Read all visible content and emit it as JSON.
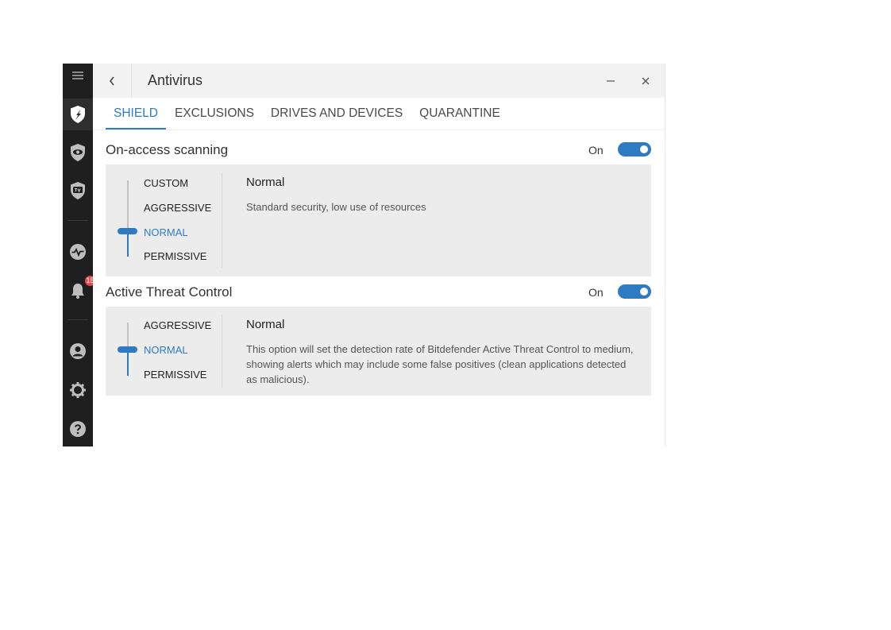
{
  "window": {
    "title": "Antivirus"
  },
  "sidebar": {
    "notifications_count": "15"
  },
  "tabs": [
    {
      "label": "SHIELD",
      "active": true
    },
    {
      "label": "EXCLUSIONS",
      "active": false
    },
    {
      "label": "DRIVES AND DEVICES",
      "active": false
    },
    {
      "label": "QUARANTINE",
      "active": false
    }
  ],
  "on_access": {
    "title": "On-access scanning",
    "toggle_label": "On",
    "toggle_on": true,
    "levels": [
      "CUSTOM",
      "AGGRESSIVE",
      "NORMAL",
      "PERMISSIVE"
    ],
    "selected_level": "NORMAL",
    "detail_title": "Normal",
    "detail_desc": "Standard security, low use of resources"
  },
  "atc": {
    "title": "Active Threat Control",
    "toggle_label": "On",
    "toggle_on": true,
    "levels": [
      "AGGRESSIVE",
      "NORMAL",
      "PERMISSIVE"
    ],
    "selected_level": "NORMAL",
    "detail_title": "Normal",
    "detail_desc": "This option will set the detection rate of Bitdefender Active Threat Control to medium, showing alerts which may include some false positives (clean applications detected as malicious)."
  },
  "colors": {
    "accent": "#2e7bc4",
    "sidebar_bg": "#1f1f1f",
    "panel_bg": "#ececec",
    "badge": "#e5484d"
  },
  "icons": [
    "menu-icon",
    "shield-icon",
    "eye-icon",
    "tv-shield-icon",
    "activity-icon",
    "bell-icon",
    "user-icon",
    "gear-icon",
    "help-icon",
    "back-icon",
    "minimize-icon",
    "close-icon"
  ]
}
